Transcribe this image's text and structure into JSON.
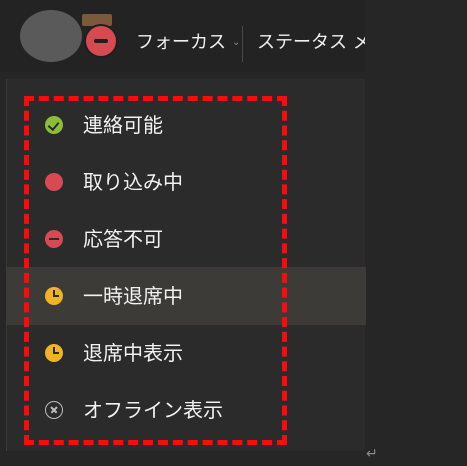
{
  "header": {
    "focus_label": "フォーカス",
    "focus_chevron": "⌄",
    "status_message_label": "ステータス メ",
    "user_presence_icon": "dnd-icon"
  },
  "colors": {
    "available": "#8cbd3a",
    "busy": "#d74a52",
    "away": "#f0b323",
    "offline": "#bdbdbd",
    "annotation": "#ff0a0a",
    "background": "#262626"
  },
  "presence_menu": {
    "items": [
      {
        "label": "連絡可能",
        "icon": "available-check-icon"
      },
      {
        "label": "取り込み中",
        "icon": "busy-dot-icon"
      },
      {
        "label": "応答不可",
        "icon": "do-not-disturb-icon"
      },
      {
        "label": "一時退席中",
        "icon": "away-clock-icon",
        "highlighted": true
      },
      {
        "label": "退席中表示",
        "icon": "away-clock-icon"
      },
      {
        "label": "オフライン表示",
        "icon": "offline-x-icon"
      }
    ]
  },
  "misc": {
    "return_mark": "↵"
  }
}
